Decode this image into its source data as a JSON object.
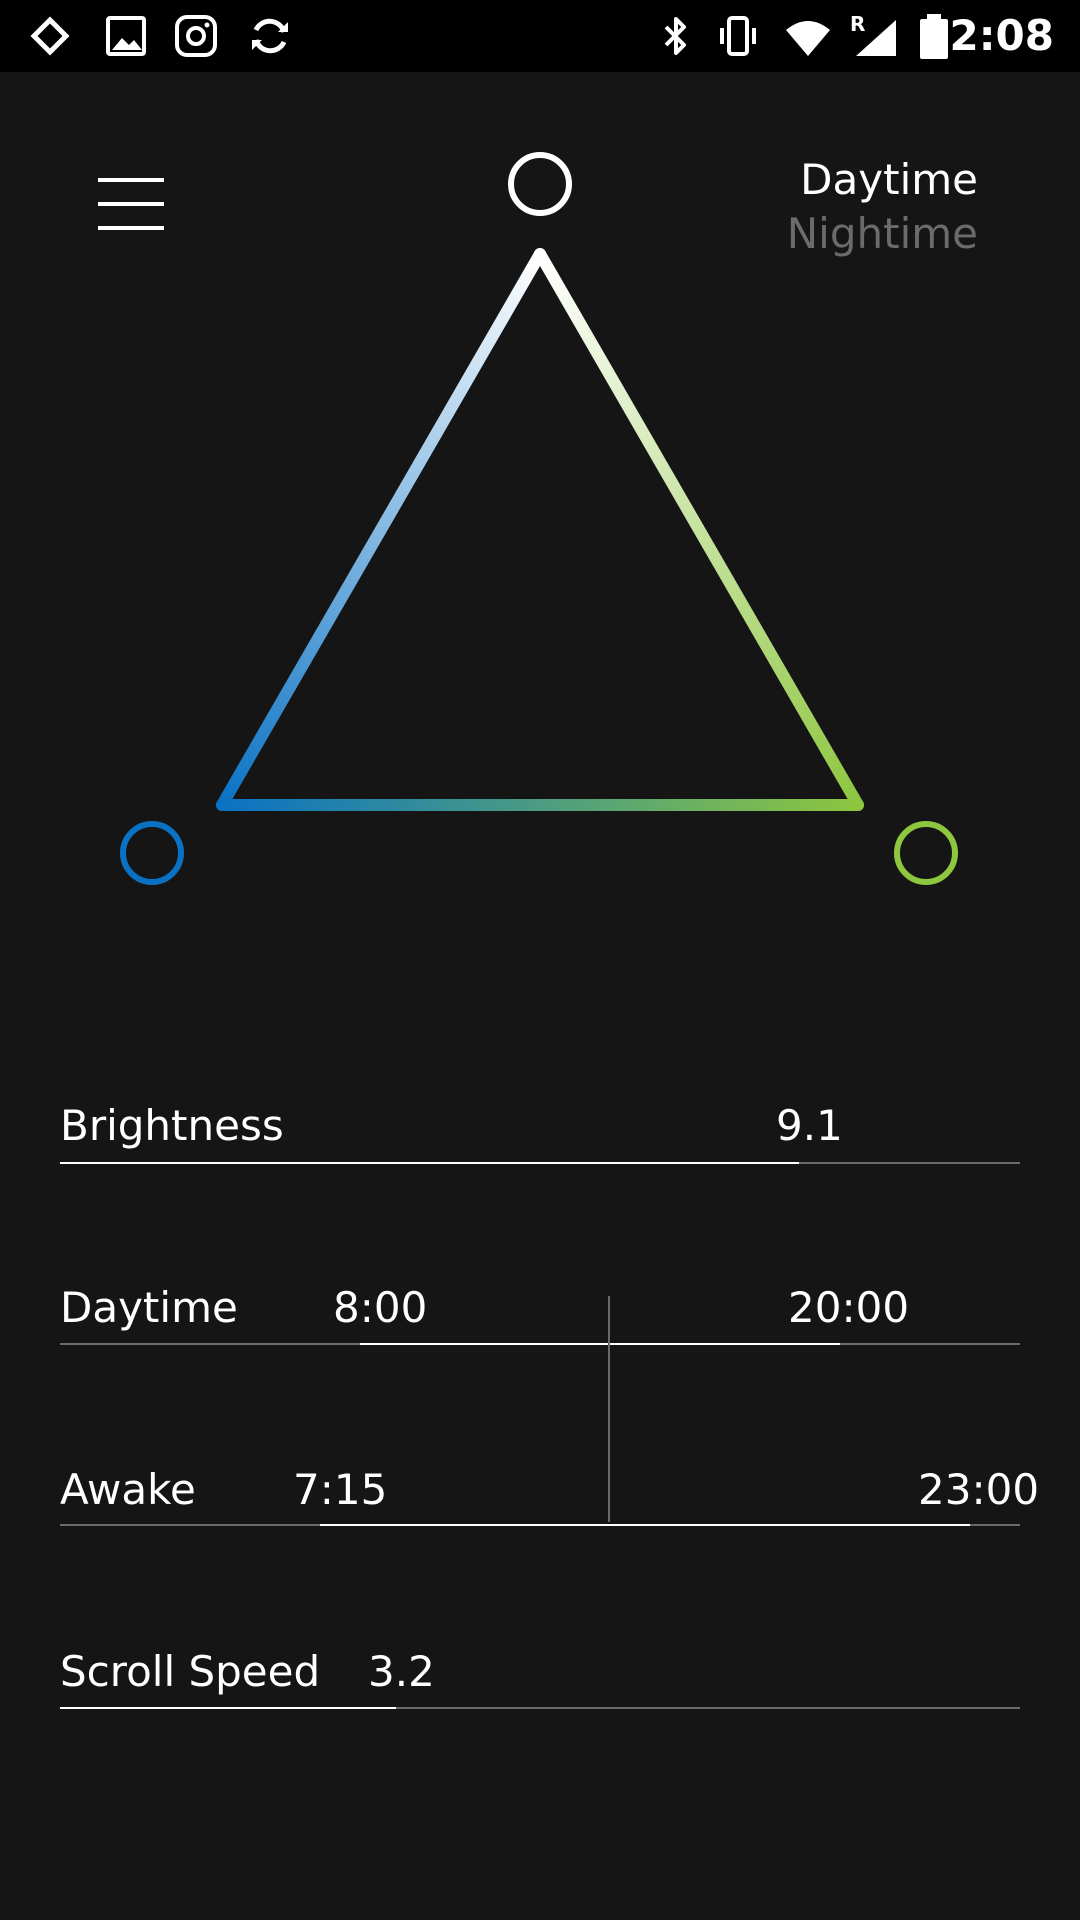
{
  "status_bar": {
    "left_icons": [
      "cast-icon",
      "image-icon",
      "instagram-icon",
      "sync-icon"
    ],
    "right_icons": [
      "bluetooth-icon",
      "vibrate-icon",
      "wifi-icon",
      "cellular-roaming-icon",
      "battery-icon"
    ],
    "roaming_indicator": "R",
    "time": "2:08"
  },
  "header": {
    "menu_icon": "hamburger-menu-icon",
    "modes": {
      "active": "Daytime",
      "inactive": "Nightime"
    }
  },
  "color_triangle": {
    "colors": {
      "top": "#ffffff",
      "left": "#0a72c4",
      "right": "#8dc63f"
    }
  },
  "settings": {
    "brightness": {
      "label": "Brightness",
      "value": "9.1",
      "level": 0.77
    },
    "daytime": {
      "label": "Daytime",
      "start": "8:00",
      "end": "20:00"
    },
    "awake": {
      "label": "Awake",
      "start": "7:15",
      "end": "23:00"
    },
    "scroll_speed": {
      "label": "Scroll Speed",
      "value": "3.2",
      "level": 0.35
    }
  }
}
